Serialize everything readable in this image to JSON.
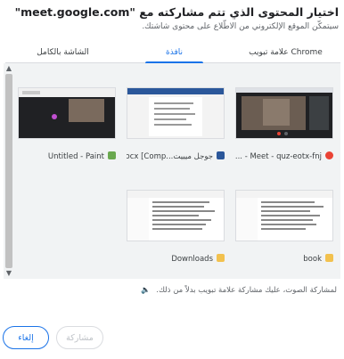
{
  "dialog": {
    "title": "اختيار المحتوى الذي تتم مشاركته مع \"meet.google.com\"",
    "subtitle": "سيتمكّن الموقع الإلكتروني من الاطّلاع على محتوى شاشتك."
  },
  "tabs": [
    {
      "label": "علامة تبويب Chrome"
    },
    {
      "label": "نافذة"
    },
    {
      "label": "الشاشة بالكامل"
    }
  ],
  "sources": [
    {
      "label": "G... - Meet - quz-eotx-fnj",
      "icon": "chrome-icon",
      "color": "#ea4335"
    },
    {
      "label": "جوجل ميييت...docx [Comp",
      "icon": "word-icon",
      "color": "#2b579a"
    },
    {
      "label": "Untitled - Paint",
      "icon": "paint-icon",
      "color": "#6aa84f"
    },
    {
      "label": "book",
      "icon": "folder-icon",
      "color": "#f2c14e"
    },
    {
      "label": "Downloads",
      "icon": "folder-icon",
      "color": "#f2c14e"
    }
  ],
  "audio_note": "لمشاركة الصوت، عليك مشاركة علامة تبويب بدلاً من ذلك.",
  "buttons": {
    "cancel": "إلغاء",
    "share": "مشاركة"
  }
}
